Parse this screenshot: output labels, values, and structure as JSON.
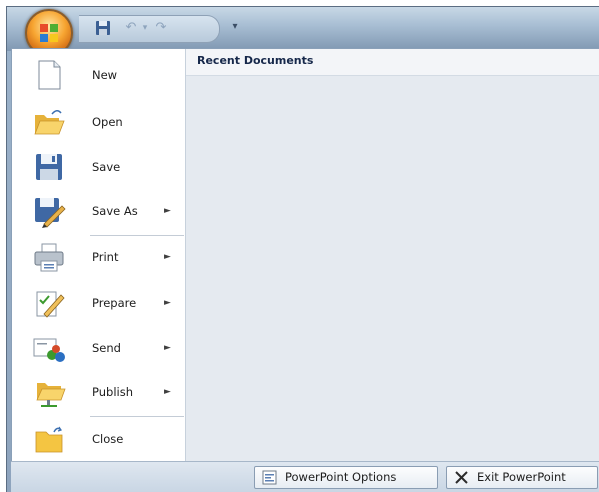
{
  "menu": {
    "items": [
      {
        "label": "New",
        "has_submenu": false,
        "icon": "new-document-icon"
      },
      {
        "label": "Open",
        "has_submenu": false,
        "icon": "open-folder-icon"
      },
      {
        "label": "Save",
        "has_submenu": false,
        "icon": "floppy-disk-icon"
      },
      {
        "label": "Save As",
        "has_submenu": true,
        "icon": "save-as-icon"
      },
      {
        "label": "Print",
        "has_submenu": true,
        "icon": "printer-icon"
      },
      {
        "label": "Prepare",
        "has_submenu": true,
        "icon": "prepare-pencil-icon"
      },
      {
        "label": "Send",
        "has_submenu": true,
        "icon": "send-icon"
      },
      {
        "label": "Publish",
        "has_submenu": true,
        "icon": "publish-folder-icon"
      },
      {
        "label": "Close",
        "has_submenu": false,
        "icon": "close-folder-icon"
      }
    ],
    "submenu_arrow": "►"
  },
  "recent": {
    "title": "Recent Documents"
  },
  "footer": {
    "options_label": "PowerPoint Options",
    "exit_label": "Exit PowerPoint"
  },
  "qat": {
    "customize_arrow": "▾"
  },
  "colors": {
    "frame": "#9cb3cb",
    "menu_right_panel": "#e5eaf0",
    "header_text": "#16284a"
  }
}
